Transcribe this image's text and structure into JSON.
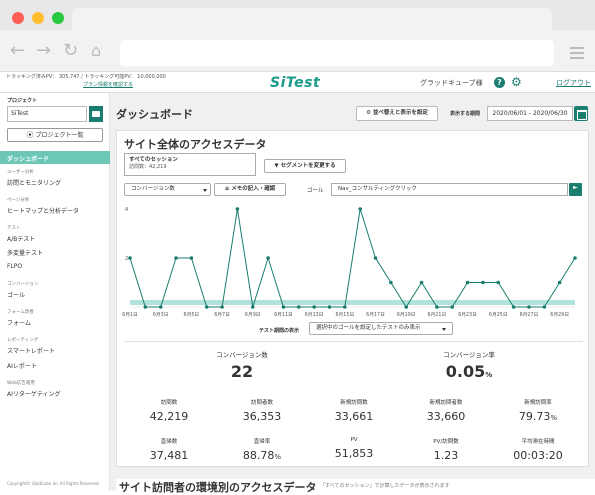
{
  "header": {
    "tracking_line": "トラッキング済みPV： 305,747 / トラッキング可能PV： 10,000,000",
    "plan_link": "プラン情報を確認する",
    "logo": "SiTest",
    "account": "グラッドキューブ様",
    "logout": "ログアウト"
  },
  "sidebar": {
    "project_label": "プロジェクト",
    "project_value": "SiTest",
    "project_list_button": "プロジェクト一覧",
    "active_item": "ダッシュボード",
    "sections": [
      {
        "title": "ユーザー分析",
        "items": [
          "訪問とモニタリング"
        ]
      },
      {
        "title": "ページ分析",
        "items": [
          "ヒートマップと分析データ"
        ]
      },
      {
        "title": "テスト",
        "items": [
          "A/Bテスト",
          "多変量テスト",
          "FLPO"
        ]
      },
      {
        "title": "コンバージョン",
        "items": [
          "ゴール"
        ]
      },
      {
        "title": "フォーム改善",
        "items": [
          "フォーム"
        ]
      },
      {
        "title": "レポーティング",
        "items": [
          "スマートレポート",
          "AIレポート"
        ]
      },
      {
        "title": "Web広告運用",
        "items": [
          "AIリターゲティング"
        ]
      }
    ],
    "copyright": "Copyright© GladCube.Inc All Rights Reserved."
  },
  "main": {
    "page_title": "ダッシュボード",
    "sort_button": "並べ替えと表示を設定",
    "period_label": "表示する期間",
    "period_value": "2020/06/01 - 2020/06/30",
    "card_title": "サイト全体のアクセスデータ",
    "session_title": "すべてのセッション",
    "session_sub": "訪問数：42,219",
    "segment_button": "セグメントを変更する",
    "metric_select": "コンバージョン数",
    "memo_button": "メモの記入・確認",
    "goal_label": "ゴール",
    "goal_value": "Nav_コンサルティングクリック",
    "test_period_label": "テスト期間の表示",
    "test_select": "選択中のゴールを設定したテストのみ表示",
    "conversions_label": "コンバージョン数",
    "conversions_value": "22",
    "cvr_label": "コンバージョン率",
    "cvr_value": "0.05",
    "cvr_unit": "%",
    "stats_row1": [
      {
        "label": "訪問数",
        "value": "42,219"
      },
      {
        "label": "訪問者数",
        "value": "36,353"
      },
      {
        "label": "新規訪問数",
        "value": "33,661"
      },
      {
        "label": "新規訪問者数",
        "value": "33,660"
      },
      {
        "label": "新規訪問率",
        "value": "79.73",
        "unit": "%"
      }
    ],
    "stats_row2": [
      {
        "label": "直帰数",
        "value": "37,481"
      },
      {
        "label": "直帰率",
        "value": "88.78",
        "unit": "%"
      },
      {
        "label": "PV",
        "value": "51,853"
      },
      {
        "label": "PV/訪問数",
        "value": "1.23"
      },
      {
        "label": "平均滞在時間",
        "value": "00:03:20"
      }
    ],
    "bottom_title": "サイト訪問者の環境別のアクセスデータ",
    "bottom_note": "「すべてのセッション」で計算したデータが表示されます"
  },
  "chart_data": {
    "type": "line",
    "x": [
      "6/1",
      "6/2",
      "6/3",
      "6/4",
      "6/5",
      "6/6",
      "6/7",
      "6/8",
      "6/9",
      "6/10",
      "6/11",
      "6/12",
      "6/13",
      "6/14",
      "6/15",
      "6/16",
      "6/17",
      "6/18",
      "6/19",
      "6/20",
      "6/21",
      "6/22",
      "6/23",
      "6/24",
      "6/25",
      "6/26",
      "6/27",
      "6/28",
      "6/29",
      "6/30"
    ],
    "x_tick_labels": [
      "6月1日",
      "6月3日",
      "6月5日",
      "6月7日",
      "6月9日",
      "6月11日",
      "6月13日",
      "6月15日",
      "6月17日",
      "6月19日",
      "6月21日",
      "6月23日",
      "6月25日",
      "6月27日",
      "6月29日"
    ],
    "y_tick_labels": [
      "4",
      "2"
    ],
    "series": [
      {
        "values": [
          2,
          0,
          0,
          2,
          2,
          0,
          0,
          4,
          0,
          2,
          0,
          0,
          0,
          0,
          0,
          4,
          2,
          1,
          0,
          1,
          0,
          0,
          1,
          1,
          1,
          0,
          0,
          0,
          1,
          2
        ]
      }
    ],
    "ylim": [
      0,
      4
    ],
    "colors": {
      "line": "#1a7d6f",
      "test_band": "#b2e3da"
    }
  }
}
